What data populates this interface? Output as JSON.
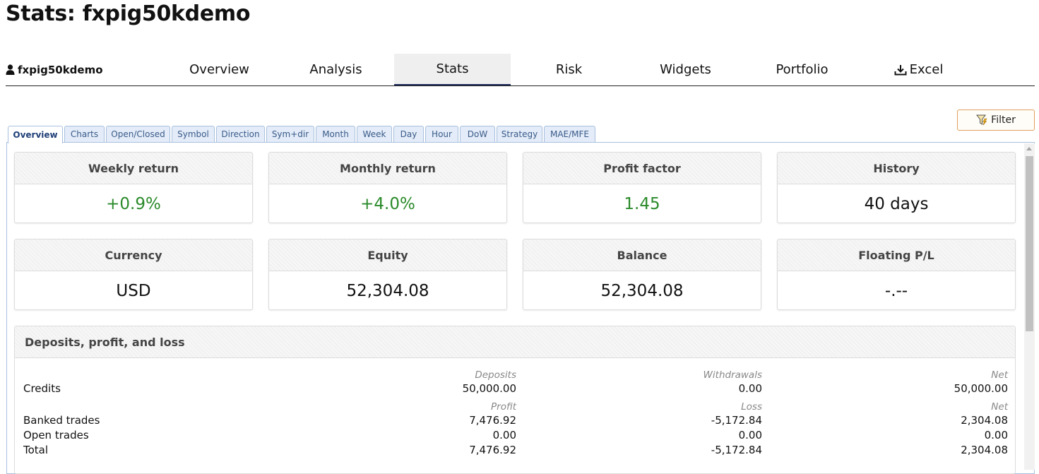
{
  "page_title": "Stats: fxpig50kdemo",
  "account": {
    "name": "fxpig50kdemo",
    "icon": "user-icon"
  },
  "main_tabs": [
    "Overview",
    "Analysis",
    "Stats",
    "Risk",
    "Widgets",
    "Portfolio",
    "Excel"
  ],
  "active_main_tab": "Stats",
  "filter_label": "Filter",
  "sub_tabs": [
    "Overview",
    "Charts",
    "Open/Closed",
    "Symbol",
    "Direction",
    "Sym+dir",
    "Month",
    "Week",
    "Day",
    "Hour",
    "DoW",
    "Strategy",
    "MAE/MFE"
  ],
  "active_sub_tab": "Overview",
  "cards": [
    {
      "title": "Weekly return",
      "value": "+0.9%"
    },
    {
      "title": "Monthly return",
      "value": "+4.0%"
    },
    {
      "title": "Profit factor",
      "value": "1.45"
    },
    {
      "title": "History",
      "value": "40 days"
    },
    {
      "title": "Currency",
      "value": "USD"
    },
    {
      "title": "Equity",
      "value": "52,304.08"
    },
    {
      "title": "Balance",
      "value": "52,304.08"
    },
    {
      "title": "Floating P/L",
      "value": "-.--"
    }
  ],
  "colors": {
    "positive": "#2a8a2a",
    "nav_active_border": "#1f2d5c",
    "subtab_border": "#a9c0de",
    "filter_border": "#e0a060"
  },
  "dpl": {
    "title": "Deposits, profit, and loss",
    "credits_headers": [
      "Deposits",
      "Withdrawals",
      "Net"
    ],
    "credits": {
      "label": "Credits",
      "values": [
        "50,000.00",
        "0.00",
        "50,000.00"
      ]
    },
    "trades_headers": [
      "Profit",
      "Loss",
      "Net"
    ],
    "rows": [
      {
        "label": "Banked trades",
        "values": [
          "7,476.92",
          "-5,172.84",
          "2,304.08"
        ]
      },
      {
        "label": "Open trades",
        "values": [
          "0.00",
          "0.00",
          "0.00"
        ]
      },
      {
        "label": "Total",
        "values": [
          "7,476.92",
          "-5,172.84",
          "2,304.08"
        ]
      }
    ]
  }
}
